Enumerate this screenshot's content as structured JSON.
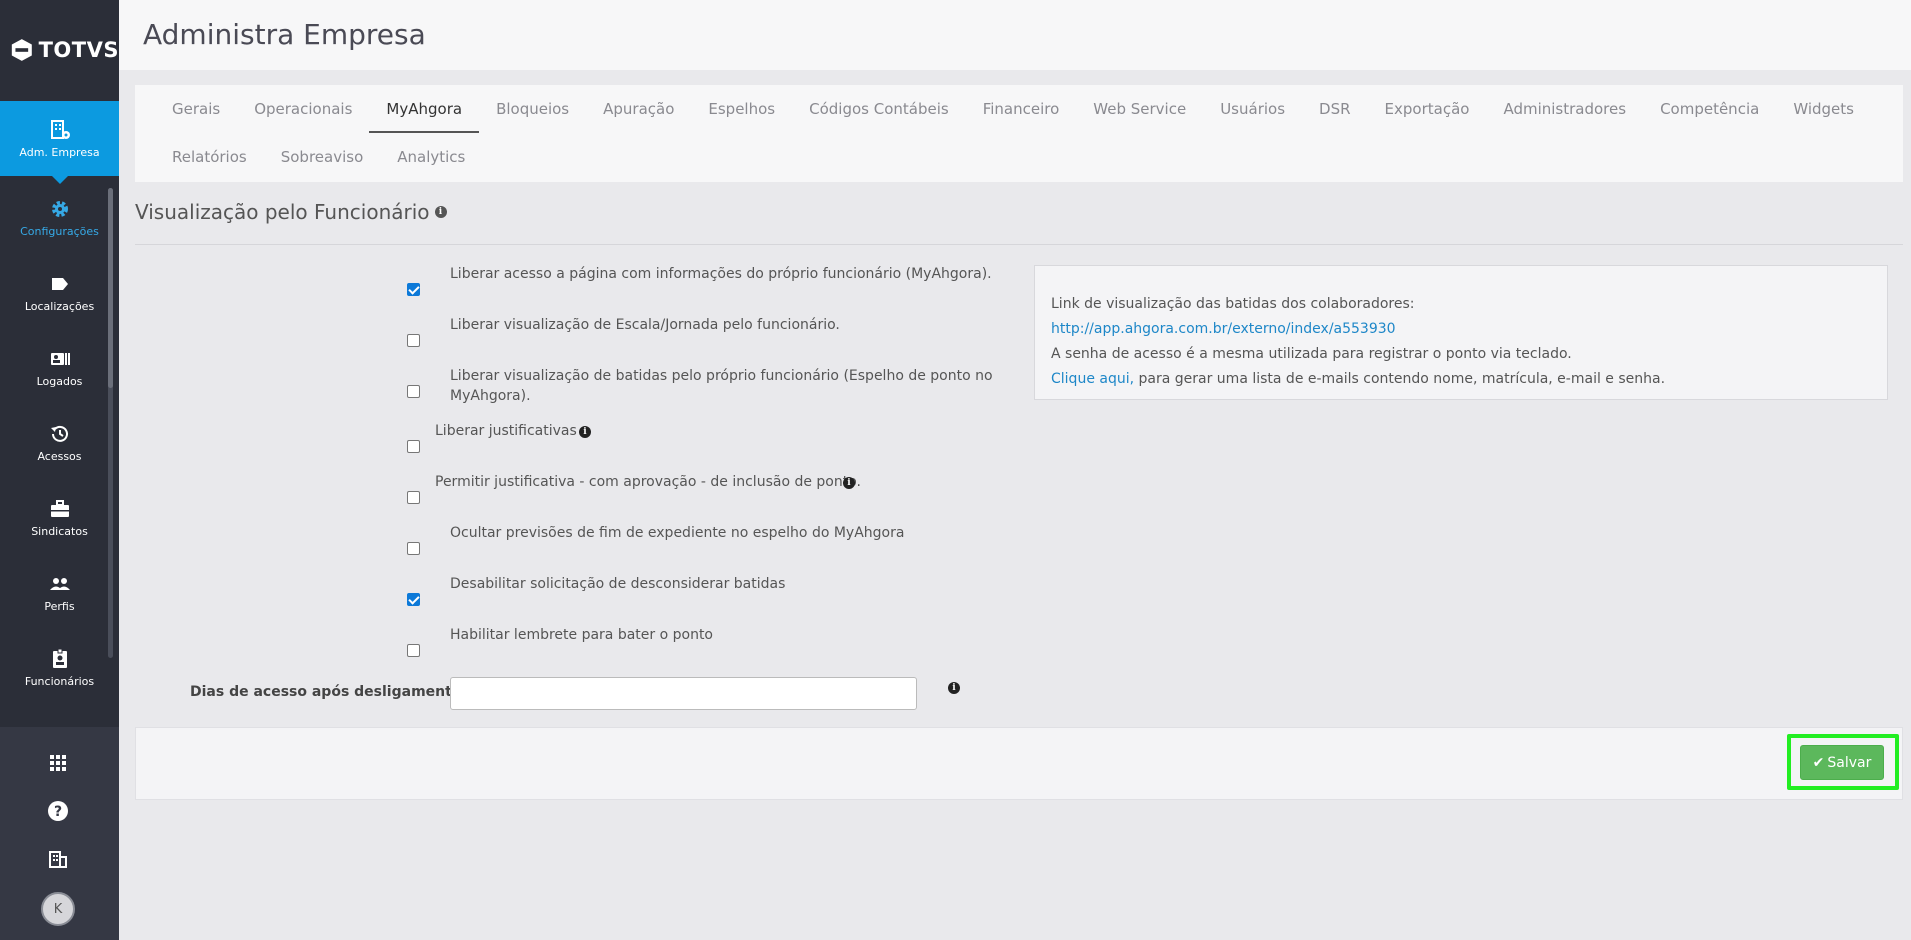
{
  "app": {
    "logo_text": "TOTVS"
  },
  "sidebar": {
    "active": {
      "label": "Adm. Empresa",
      "icon": "company-admin-icon"
    },
    "items": [
      {
        "label": "Configurações",
        "icon": "gear-icon",
        "selected": true
      },
      {
        "label": "Localizações",
        "icon": "tag-icon"
      },
      {
        "label": "Logados",
        "icon": "id-card-icon"
      },
      {
        "label": "Acessos",
        "icon": "history-icon"
      },
      {
        "label": "Sindicatos",
        "icon": "briefcase-icon"
      },
      {
        "label": "Perfis",
        "icon": "users-icon"
      },
      {
        "label": "Funcionários",
        "icon": "badge-icon"
      }
    ],
    "bottom": {
      "avatar_initial": "K"
    }
  },
  "header": {
    "title": "Administra Empresa"
  },
  "tabs": [
    {
      "label": "Gerais"
    },
    {
      "label": "Operacionais"
    },
    {
      "label": "MyAhgora",
      "active": true
    },
    {
      "label": "Bloqueios"
    },
    {
      "label": "Apuração"
    },
    {
      "label": "Espelhos"
    },
    {
      "label": "Códigos Contábeis"
    },
    {
      "label": "Financeiro"
    },
    {
      "label": "Web Service"
    },
    {
      "label": "Usuários"
    },
    {
      "label": "DSR"
    },
    {
      "label": "Exportação"
    },
    {
      "label": "Administradores"
    },
    {
      "label": "Competência"
    },
    {
      "label": "Widgets"
    },
    {
      "label": "Relatórios"
    },
    {
      "label": "Sobreaviso"
    },
    {
      "label": "Analytics"
    }
  ],
  "section": {
    "title": "Visualização pelo Funcionário"
  },
  "options": [
    {
      "label": "Liberar acesso a página com informações do próprio funcionário (MyAhgora).",
      "checked": true
    },
    {
      "label": "Liberar visualização de Escala/Jornada pelo funcionário.",
      "checked": false
    },
    {
      "label": "Liberar visualização de batidas pelo próprio funcionário (Espelho de ponto no MyAhgora).",
      "checked": false
    },
    {
      "label": "Liberar justificativas",
      "checked": false
    },
    {
      "label": "Permitir justificativa - com aprovação - de inclusão de ponto.",
      "checked": false
    },
    {
      "label": "Ocultar previsões de fim de expediente no espelho do MyAhgora",
      "checked": false
    },
    {
      "label": "Desabilitar solicitação de desconsiderar batidas",
      "checked": true
    },
    {
      "label": "Habilitar lembrete para bater o ponto",
      "checked": false
    }
  ],
  "info_box": {
    "line1": "Link de visualização das batidas dos colaboradores:",
    "link": "http://app.ahgora.com.br/externo/index/a553930",
    "line2": "A senha de acesso é a mesma utilizada para registrar o ponto via teclado.",
    "click_link": "Clique aqui,",
    "line3": " para gerar uma lista de e-mails contendo nome, matrícula, e-mail e senha."
  },
  "field": {
    "label": "Dias de acesso após desligamento",
    "value": ""
  },
  "footer": {
    "save_label": "Salvar"
  },
  "colors": {
    "accent": "#0c9ae0",
    "save": "#5cb85c",
    "highlight": "#22ee22",
    "sidebar": "#2b2e38"
  }
}
